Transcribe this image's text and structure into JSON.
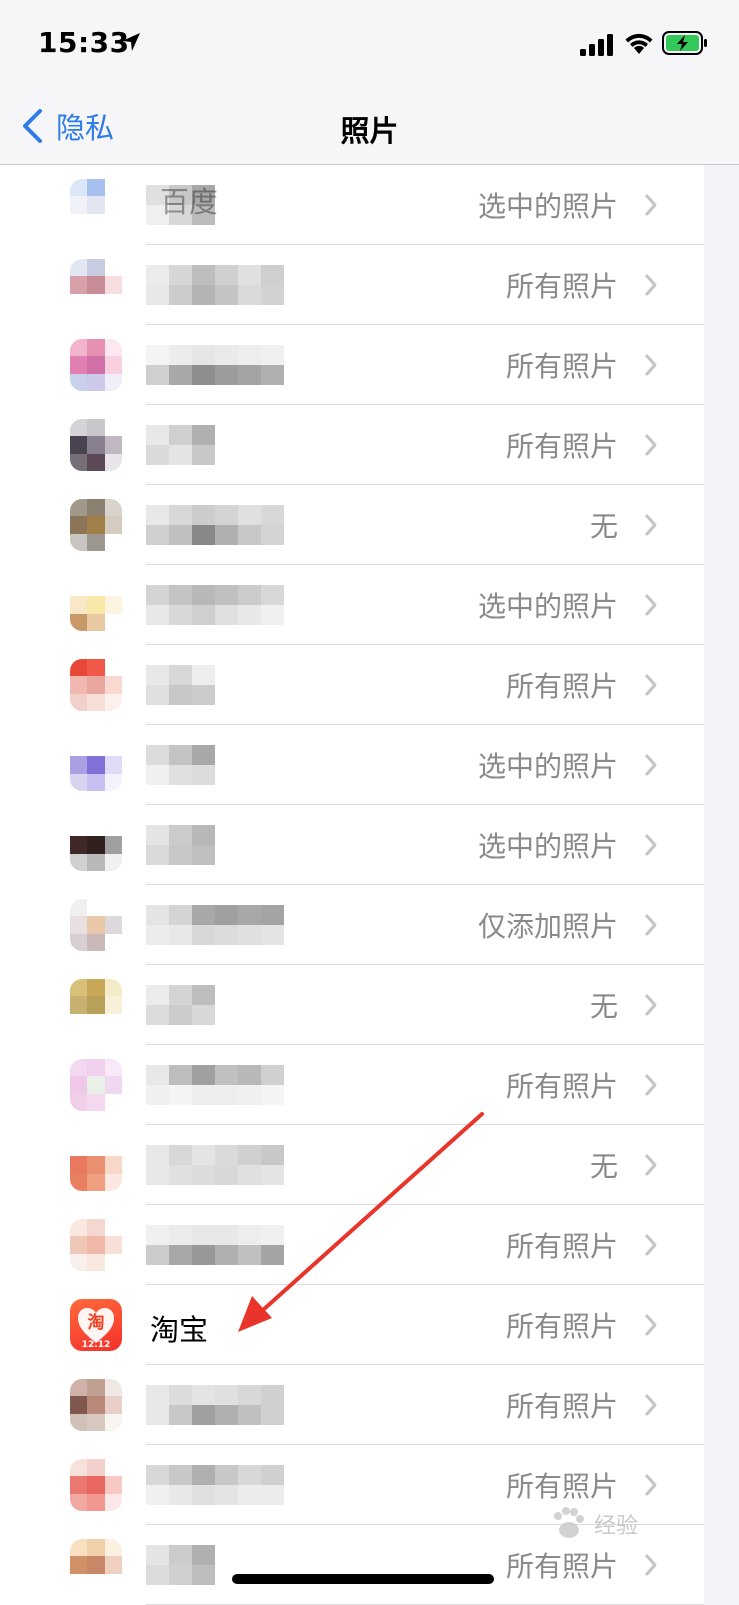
{
  "status": {
    "time": "15:33"
  },
  "nav": {
    "back_label": "隐私",
    "title": "照片"
  },
  "rows": [
    {
      "name": "百度",
      "permission": "选中的照片",
      "icon_colors": [
        "#dbe6f6",
        "#a8c0ef",
        "#ffffff",
        "#f0f2f8",
        "#e2e6f2",
        "#ffffff",
        "#ffffff",
        "#ffffff",
        "#ffffff"
      ],
      "name_colors": [
        "#e0e0e0",
        "#c8c8c8",
        "#a8a8a8",
        "#efefef",
        "#d8d8d8",
        "#bcbcbc"
      ]
    },
    {
      "name": "",
      "permission": "所有照片",
      "icon_colors": [
        "#e2e6f0",
        "#c8cce0",
        "#ffffff",
        "#d8a0a8",
        "#c88c98",
        "#f5dde0",
        "#ffffff",
        "#ffffff",
        "#ffffff"
      ],
      "name_colors": [
        "#ececec",
        "#d6d6d6",
        "#bdbdbd",
        "#d0d0d0",
        "#e0e0e0",
        "#cfcfcf",
        "#e8e8e8",
        "#cccccc",
        "#b4b4b4",
        "#c4c4c4",
        "#dadada",
        "#d2d2d2"
      ]
    },
    {
      "name": "",
      "permission": "所有照片",
      "icon_colors": [
        "#f2b4cc",
        "#e890b4",
        "#fce8ee",
        "#e080b0",
        "#d070a8",
        "#f8d0e0",
        "#c8d0ec",
        "#ccc8e8",
        "#f0eef8"
      ],
      "name_colors": [
        "#f4f4f4",
        "#ececec",
        "#e6e6e6",
        "#eaeaea",
        "#ededed",
        "#f0f0f0",
        "#cfcfcf",
        "#a8a8a8",
        "#8e8e8e",
        "#9c9c9c",
        "#a4a4a4",
        "#b0b0b0"
      ]
    },
    {
      "name": "",
      "permission": "所有照片",
      "icon_colors": [
        "#d4d4d8",
        "#c8c8cc",
        "#ffffff",
        "#4a4450",
        "#888090",
        "#c0b8c0",
        "#787078",
        "#5c4a58",
        "#e8e4e8"
      ],
      "name_colors": [
        "#e8e8e8",
        "#d0d0d0",
        "#b0b0b0",
        "#dadada",
        "#e4e4e4",
        "#c8c8c8"
      ]
    },
    {
      "name": "",
      "permission": "无",
      "icon_colors": [
        "#a09888",
        "#8c8070",
        "#d8d4cc",
        "#8c7458",
        "#a08048",
        "#d4ccc0",
        "#c8c4c0",
        "#9c9890",
        "#ffffff"
      ],
      "name_colors": [
        "#e8e8e8",
        "#d8d8d8",
        "#cccccc",
        "#d4d4d4",
        "#e0e0e0",
        "#d8d8d8",
        "#d0d0d0",
        "#c0c0c0",
        "#888888",
        "#b0b0b0",
        "#c8c8c8",
        "#d4d4d4"
      ]
    },
    {
      "name": "",
      "permission": "选中的照片",
      "icon_colors": [
        "#ffffff",
        "#ffffff",
        "#ffffff",
        "#f8e8c8",
        "#f8e8a8",
        "#fcf4e0",
        "#c89868",
        "#e8c8a0",
        "#ffffff"
      ],
      "name_colors": [
        "#d4d4d4",
        "#c4c4c4",
        "#b8b8b8",
        "#c0c0c0",
        "#cccccc",
        "#d8d8d8",
        "#e8e8e8",
        "#d8d8d8",
        "#cfcfcf",
        "#e0e0e0",
        "#e8e8e8",
        "#f0f0f0"
      ]
    },
    {
      "name": "",
      "permission": "所有照片",
      "icon_colors": [
        "#e84838",
        "#f05848",
        "#ffffff",
        "#f0b8b0",
        "#e8a8a0",
        "#f8d8d0",
        "#f0d0c8",
        "#f8e0d8",
        "#fcf0ec"
      ],
      "name_colors": [
        "#e8e8e8",
        "#d8d8d8",
        "#eeeeee",
        "#e0e0e0",
        "#c8c8c8",
        "#cccccc"
      ]
    },
    {
      "name": "",
      "permission": "选中的照片",
      "icon_colors": [
        "#ffffff",
        "#ffffff",
        "#ffffff",
        "#a8a0e0",
        "#8070d8",
        "#e0dcf8",
        "#d8d4f0",
        "#c8c0f0",
        "#f4f2fc"
      ],
      "name_colors": [
        "#dcdcdc",
        "#c4c4c4",
        "#a8a8a8",
        "#f0f0f0",
        "#e0e0e0",
        "#dcdcdc"
      ]
    },
    {
      "name": "",
      "permission": "选中的照片",
      "icon_colors": [
        "#ffffff",
        "#ffffff",
        "#ffffff",
        "#402828",
        "#302020",
        "#a0a0a0",
        "#d0d0d0",
        "#b8b8b8",
        "#f0f0f0"
      ],
      "name_colors": [
        "#e4e4e4",
        "#cccccc",
        "#b8b8b8",
        "#dadada",
        "#c8c8c8",
        "#bfbfbf"
      ]
    },
    {
      "name": "",
      "permission": "仅添加照片",
      "icon_colors": [
        "#f0f0f0",
        "#ffffff",
        "#ffffff",
        "#e8e0e0",
        "#e8c8a8",
        "#dcd8dc",
        "#d8d0d0",
        "#c8b8b8",
        "#ffffff"
      ],
      "name_colors": [
        "#e4e4e4",
        "#d4d4d4",
        "#a8a8a8",
        "#a0a0a0",
        "#a8a8a8",
        "#a4a4a4",
        "#ececec",
        "#e8e8e8",
        "#d8d8d8",
        "#dcdcdc",
        "#e0e0e0",
        "#e4e4e4"
      ]
    },
    {
      "name": "",
      "permission": "无",
      "icon_colors": [
        "#d8c078",
        "#c8a858",
        "#f4ecc8",
        "#c8b070",
        "#b8a058",
        "#f8f0d8",
        "#ffffff",
        "#ffffff",
        "#ffffff"
      ],
      "name_colors": [
        "#ececec",
        "#d4d4d4",
        "#bdbdbd",
        "#dcdcdc",
        "#cccccc",
        "#d8d8d8"
      ]
    },
    {
      "name": "",
      "permission": "所有照片",
      "icon_colors": [
        "#f4d8f0",
        "#f0d0ec",
        "#f8e8f8",
        "#f0c8e8",
        "#e8f0e8",
        "#f0d8f0",
        "#f0d0e8",
        "#f4d8f0",
        "#ffffff"
      ],
      "name_colors": [
        "#e8e8e8",
        "#bdbdbd",
        "#a0a0a0",
        "#c0c0c0",
        "#b8b8b8",
        "#d0d0d0",
        "#f0f0f0",
        "#f4f4f4",
        "#eeeeee",
        "#eeeeee",
        "#f0f0f0",
        "#f4f4f4"
      ]
    },
    {
      "name": "",
      "permission": "无",
      "icon_colors": [
        "#ffffff",
        "#ffffff",
        "#ffffff",
        "#e87860",
        "#e89070",
        "#f8d8c8",
        "#e88060",
        "#f0a080",
        "#fce8e0"
      ],
      "name_colors": [
        "#e8e8e8",
        "#d8d8d8",
        "#e4e4e4",
        "#dadada",
        "#d0d0d0",
        "#c8c8c8",
        "#e8e8e8",
        "#e0e0e0",
        "#dcdcdc",
        "#d8d8d8",
        "#e0e0e0",
        "#e4e4e4"
      ]
    },
    {
      "name": "",
      "permission": "所有照片",
      "icon_colors": [
        "#f8e8e0",
        "#f4d8d0",
        "#ffffff",
        "#f0c8b8",
        "#f0b8a8",
        "#f8e0d8",
        "#f8f0ec",
        "#f8e8e0",
        "#ffffff"
      ],
      "name_colors": [
        "#f0f0f0",
        "#ececec",
        "#e8e8e8",
        "#e8e8e8",
        "#ededed",
        "#f0f0f0",
        "#cccccc",
        "#a8a8a8",
        "#989898",
        "#b0b0b0",
        "#c0c0c0",
        "#a4a4a4"
      ]
    },
    {
      "name": "淘宝",
      "permission": "所有照片",
      "taobao": true,
      "icon_badge": "淘",
      "icon_date": "12.12"
    },
    {
      "name": "",
      "permission": "所有照片",
      "icon_colors": [
        "#d0b0a8",
        "#c0a090",
        "#f0e8e4",
        "#805850",
        "#b88878",
        "#e8d0c8",
        "#d0c0b8",
        "#d8c8c0",
        "#f8f4f0"
      ],
      "name_colors": [
        "#e8e8e8",
        "#dcdcdc",
        "#e4e4e4",
        "#e0e0e0",
        "#d8d8d8",
        "#d0d0d0",
        "#e8e8e8",
        "#c8c8c8",
        "#a0a0a0",
        "#b0b0b0",
        "#c0c0c0",
        "#d0d0d0"
      ]
    },
    {
      "name": "",
      "permission": "所有照片",
      "icon_colors": [
        "#f8e0dc",
        "#f4d0cc",
        "#ffffff",
        "#e87870",
        "#e86860",
        "#f8c8c4",
        "#f0a8a0",
        "#f09890",
        "#fce8e8"
      ],
      "name_colors": [
        "#d8d8d8",
        "#c8c8c8",
        "#b0b0b0",
        "#c8c8c8",
        "#d8d8d8",
        "#d0d0d0",
        "#f0f0f0",
        "#e8e8e8",
        "#e0e0e0",
        "#e4e4e4",
        "#ececec",
        "#ececec"
      ]
    },
    {
      "name": "",
      "permission": "所有照片",
      "icon_colors": [
        "#f8e0c0",
        "#f0d0a8",
        "#fcf0e0",
        "#d09068",
        "#c88868",
        "#f0d0c0",
        "#ffffff",
        "#ffffff",
        "#ffffff"
      ],
      "name_colors": [
        "#e4e4e4",
        "#cccccc",
        "#b0b0b0",
        "#dcdcdc",
        "#d0d0d0",
        "#bebebe"
      ]
    }
  ],
  "watermark": {
    "text": "经验"
  },
  "colors": {
    "accent": "#2f7ce6",
    "secondary_text": "#8a8a8e",
    "arrow": "#e8342a"
  }
}
